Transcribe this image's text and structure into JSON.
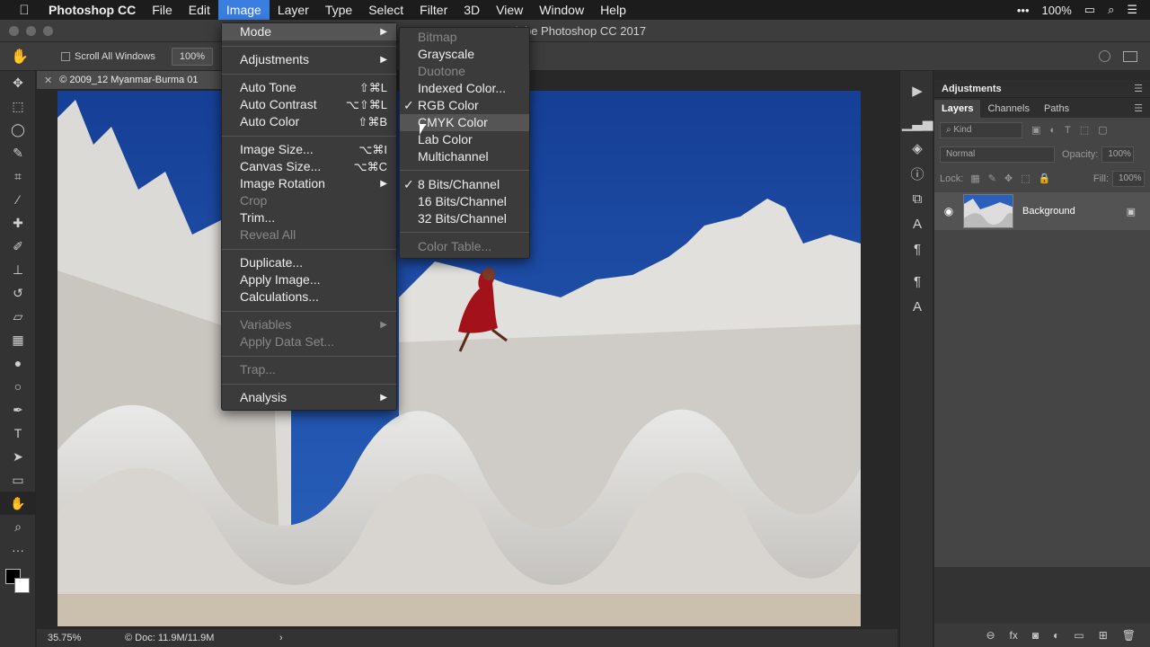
{
  "menubar": {
    "app": "Photoshop CC",
    "items": [
      "File",
      "Edit",
      "Image",
      "Layer",
      "Type",
      "Select",
      "Filter",
      "3D",
      "View",
      "Window",
      "Help"
    ],
    "active": "Image",
    "more": "•••",
    "battery": "100%"
  },
  "window": {
    "title": "Adobe Photoshop CC 2017",
    "title_visible_part": "e Photoshop CC 2017"
  },
  "options": {
    "scroll_all": "Scroll All Windows",
    "zoom_btn": "100%"
  },
  "document": {
    "tab_title": "© 2009_12 Myanmar-Burma 01",
    "zoom": "35.75%",
    "doc_size": "Doc: 11.9M/11.9M"
  },
  "image_menu": {
    "items": [
      {
        "label": "Mode",
        "submenu": true,
        "highlight": true
      },
      {
        "label": "Adjustments",
        "submenu": true
      },
      {
        "label": "Auto Tone",
        "shortcut": "⇧⌘L"
      },
      {
        "label": "Auto Contrast",
        "shortcut": "⌥⇧⌘L"
      },
      {
        "label": "Auto Color",
        "shortcut": "⇧⌘B"
      },
      {
        "label": "Image Size...",
        "shortcut": "⌥⌘I"
      },
      {
        "label": "Canvas Size...",
        "shortcut": "⌥⌘C"
      },
      {
        "label": "Image Rotation",
        "submenu": true
      },
      {
        "label": "Crop",
        "disabled": true
      },
      {
        "label": "Trim..."
      },
      {
        "label": "Reveal All",
        "disabled": true
      },
      {
        "label": "Duplicate..."
      },
      {
        "label": "Apply Image..."
      },
      {
        "label": "Calculations..."
      },
      {
        "label": "Variables",
        "submenu": true,
        "disabled": true
      },
      {
        "label": "Apply Data Set...",
        "disabled": true
      },
      {
        "label": "Trap...",
        "disabled": true
      },
      {
        "label": "Analysis",
        "submenu": true
      }
    ]
  },
  "mode_menu": {
    "items": [
      {
        "label": "Bitmap",
        "disabled": true
      },
      {
        "label": "Grayscale"
      },
      {
        "label": "Duotone",
        "disabled": true
      },
      {
        "label": "Indexed Color..."
      },
      {
        "label": "RGB Color",
        "checked": true
      },
      {
        "label": "CMYK Color",
        "highlight": true
      },
      {
        "label": "Lab Color"
      },
      {
        "label": "Multichannel"
      },
      {
        "label": "8 Bits/Channel",
        "checked": true
      },
      {
        "label": "16 Bits/Channel"
      },
      {
        "label": "32 Bits/Channel"
      },
      {
        "label": "Color Table...",
        "disabled": true
      }
    ],
    "check_mark": "✓"
  },
  "panels": {
    "adjustments_tab": "Adjustments",
    "tabs": [
      "Layers",
      "Channels",
      "Paths"
    ],
    "kind": "Kind",
    "blend_mode": "Normal",
    "opacity_label": "Opacity:",
    "opacity_value": "100%",
    "lock_label": "Lock:",
    "fill_label": "Fill:",
    "fill_value": "100%",
    "layer_name": "Background"
  },
  "colors": {
    "menu_bg": "#3b3b3b",
    "highlight": "#555555",
    "menubar_active": "#3a7ee0",
    "sky": "#1f4fa8"
  }
}
